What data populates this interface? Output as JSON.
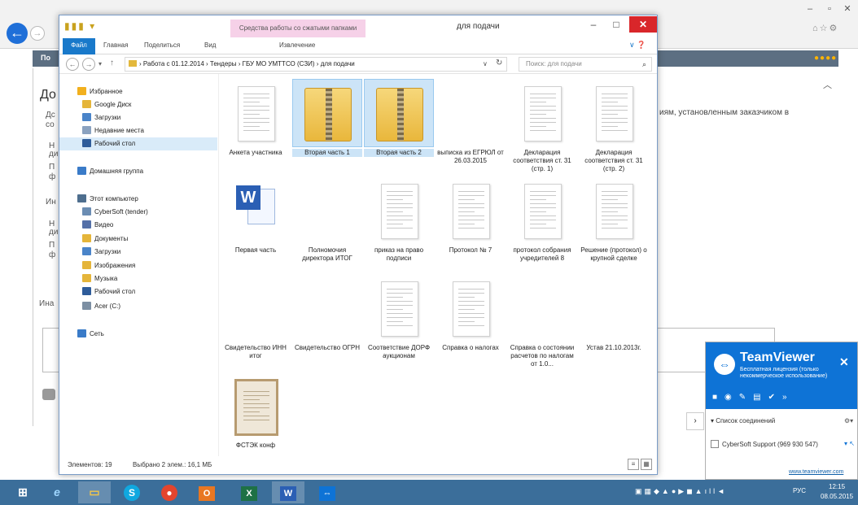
{
  "browser": {
    "header_label": "По",
    "page_heading": "До",
    "fragments": [
      "Дс",
      "со",
      "Н",
      "ди",
      "П",
      "ф",
      "Ин",
      "Н",
      "ди",
      "П",
      "ф",
      "Ина"
    ],
    "requirement_text": "иям, установленным заказчиком в",
    "window_controls": [
      "–",
      "▫",
      "✕"
    ],
    "right_icons": "⌂☆⚙"
  },
  "explorer": {
    "title": "для подачи",
    "context_tools": "Средства работы со сжатыми папками",
    "window_controls": {
      "minimize": "–",
      "maximize": "□",
      "close": "✕"
    },
    "ribbon_tabs": {
      "file": "Файл",
      "home": "Главная",
      "share": "Поделиться",
      "view": "Вид",
      "extract": "Извлечение"
    },
    "nav_buttons": {
      "back": "←",
      "forward": "→",
      "recent": "▾",
      "up": "↑"
    },
    "address": {
      "path": "› Работа с 01.12.2014 › Тендеры › ГБУ МО УМТТСО (СЗИ) › для подачи",
      "dropdown": "∨",
      "refresh": "↻"
    },
    "search": {
      "placeholder": "Поиск: для подачи",
      "icon": "⌕"
    },
    "nav_pane": [
      {
        "label": "Избранное",
        "icon": "star",
        "color": "#f2b01e"
      },
      {
        "label": "Google Диск",
        "icon": "gdrive",
        "color": "#e5b53a"
      },
      {
        "label": "Загрузки",
        "icon": "downloads",
        "color": "#4a84c9"
      },
      {
        "label": "Недавние места",
        "icon": "recent",
        "color": "#8aa2c0"
      },
      {
        "label": "Рабочий стол",
        "icon": "desktop",
        "color": "#2e5c9a"
      },
      {
        "label": "Домашняя группа",
        "icon": "homegroup",
        "color": "#3a7bc8"
      },
      {
        "label": "Этот компьютер",
        "icon": "computer",
        "color": "#4e6e8e"
      },
      {
        "label": "CyberSoft (tender)",
        "icon": "network-drive",
        "color": "#6b8db3"
      },
      {
        "label": "Видео",
        "icon": "videos",
        "color": "#5470a8"
      },
      {
        "label": "Документы",
        "icon": "documents",
        "color": "#e5b53a"
      },
      {
        "label": "Загрузки",
        "icon": "downloads",
        "color": "#4a84c9"
      },
      {
        "label": "Изображения",
        "icon": "pictures",
        "color": "#e5b53a"
      },
      {
        "label": "Музыка",
        "icon": "music",
        "color": "#e5b53a"
      },
      {
        "label": "Рабочий стол",
        "icon": "desktop",
        "color": "#2e5c9a"
      },
      {
        "label": "Acer (C:)",
        "icon": "drive",
        "color": "#7c8fa3"
      },
      {
        "label": "Сеть",
        "icon": "network",
        "color": "#3a7bc8"
      }
    ],
    "files": [
      {
        "name": "Анкета участника",
        "type": "doc"
      },
      {
        "name": "Вторая часть 1",
        "type": "zip",
        "selected": true
      },
      {
        "name": "Вторая часть 2",
        "type": "zip",
        "selected": true
      },
      {
        "name": "выписка из ЕГРЮЛ от 26.03.2015",
        "type": "none"
      },
      {
        "name": "Декларация соответствия ст. 31 (стр. 1)",
        "type": "doc"
      },
      {
        "name": "Декларация соответствия ст. 31 (стр. 2)",
        "type": "doc"
      },
      {
        "name": "Первая часть",
        "type": "word"
      },
      {
        "name": "Полномочия директора ИТОГ",
        "type": "none"
      },
      {
        "name": "приказ на право подписи",
        "type": "doc"
      },
      {
        "name": "Протокол № 7",
        "type": "doc"
      },
      {
        "name": "протокол собрания учредителей 8",
        "type": "doc"
      },
      {
        "name": "Решение (протокол) о крупной сделке",
        "type": "doc"
      },
      {
        "name": "Свидетельство ИНН итог",
        "type": "none"
      },
      {
        "name": "Свидетельство ОГРН",
        "type": "none"
      },
      {
        "name": "Соответствие ДОРФ аукционам",
        "type": "doc"
      },
      {
        "name": "Справка о налогах",
        "type": "doc"
      },
      {
        "name": "Справка о состоянии расчетов по налогам от 1.0...",
        "type": "none"
      },
      {
        "name": "Устав 21.10.2013г.",
        "type": "none"
      },
      {
        "name": "ФСТЭК конф",
        "type": "cert"
      }
    ],
    "status": {
      "count": "Элементов: 19",
      "selected": "Выбрано 2 элем.: 16,1 МБ"
    }
  },
  "teamviewer": {
    "brand": "TeamViewer",
    "license": "Бесплатная лицензия (только некоммерческое использование)",
    "close": "✕",
    "expand": "›",
    "connections_title": "▾ Список соединений",
    "gear": "⚙▾",
    "connection_item": "CyberSoft Support (969 930 547)",
    "connection_arrow": "▾  ↖",
    "link": "www.teamviewer.com"
  },
  "taskbar": {
    "apps": [
      "windows",
      "internet-explorer",
      "file-explorer",
      "skype",
      "chrome",
      "outlook",
      "excel",
      "word",
      "teamviewer"
    ],
    "language": "РУС",
    "time": "12:15",
    "date": "08.05.2015"
  }
}
